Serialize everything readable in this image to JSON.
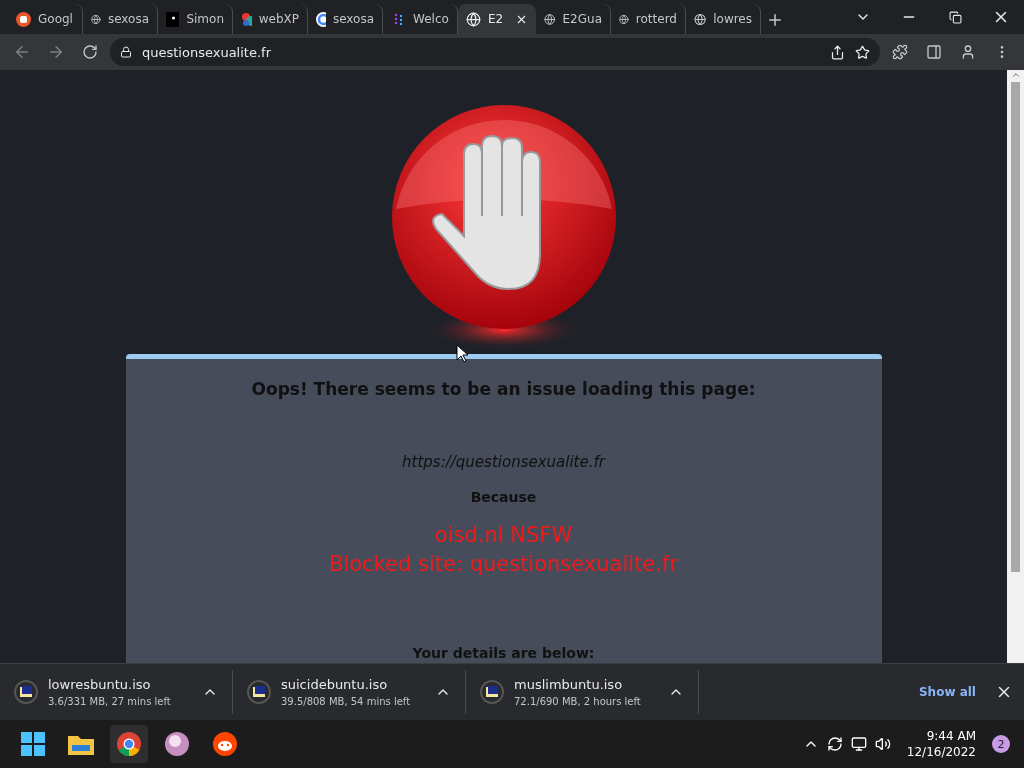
{
  "tabs": [
    {
      "title": "Googl",
      "kind": "orange",
      "selected": false
    },
    {
      "title": "sexosa",
      "kind": "globe",
      "selected": false
    },
    {
      "title": "Simon",
      "kind": "dark",
      "selected": false
    },
    {
      "title": "webXP",
      "kind": "multi",
      "selected": false
    },
    {
      "title": "sexosa",
      "kind": "google",
      "selected": false
    },
    {
      "title": "Welco",
      "kind": "dots",
      "selected": false
    },
    {
      "title": "E2",
      "kind": "globe",
      "selected": true
    },
    {
      "title": "E2Gua",
      "kind": "globe",
      "selected": false
    },
    {
      "title": "rotterd",
      "kind": "globe",
      "selected": false
    },
    {
      "title": "lowres",
      "kind": "globe",
      "selected": false
    }
  ],
  "address_bar": {
    "url": "questionsexualite.fr"
  },
  "page": {
    "heading": "Oops! There seems to be an issue loading this page:",
    "url": "https://questionsexualite.fr",
    "because": "Because",
    "reasons": [
      "oisd.nl NSFW",
      "Blocked site: questionsexualite.fr"
    ],
    "details": "Your details are below:"
  },
  "downloads": [
    {
      "name": "lowresbuntu.iso",
      "status": "3.6/331 MB, 27 mins left"
    },
    {
      "name": "suicidebuntu.iso",
      "status": "39.5/808 MB, 54 mins left"
    },
    {
      "name": "muslimbuntu.iso",
      "status": "72.1/690 MB, 2 hours left"
    }
  ],
  "show_all": "Show all",
  "taskbar": {
    "apps": [
      {
        "kind": "start",
        "selected": false
      },
      {
        "kind": "folder",
        "selected": false
      },
      {
        "kind": "chrome",
        "selected": true
      },
      {
        "kind": "orb",
        "selected": false
      },
      {
        "kind": "reddit",
        "selected": false
      }
    ],
    "time": "9:44 AM",
    "date": "12/16/2022",
    "notifications": "2"
  }
}
